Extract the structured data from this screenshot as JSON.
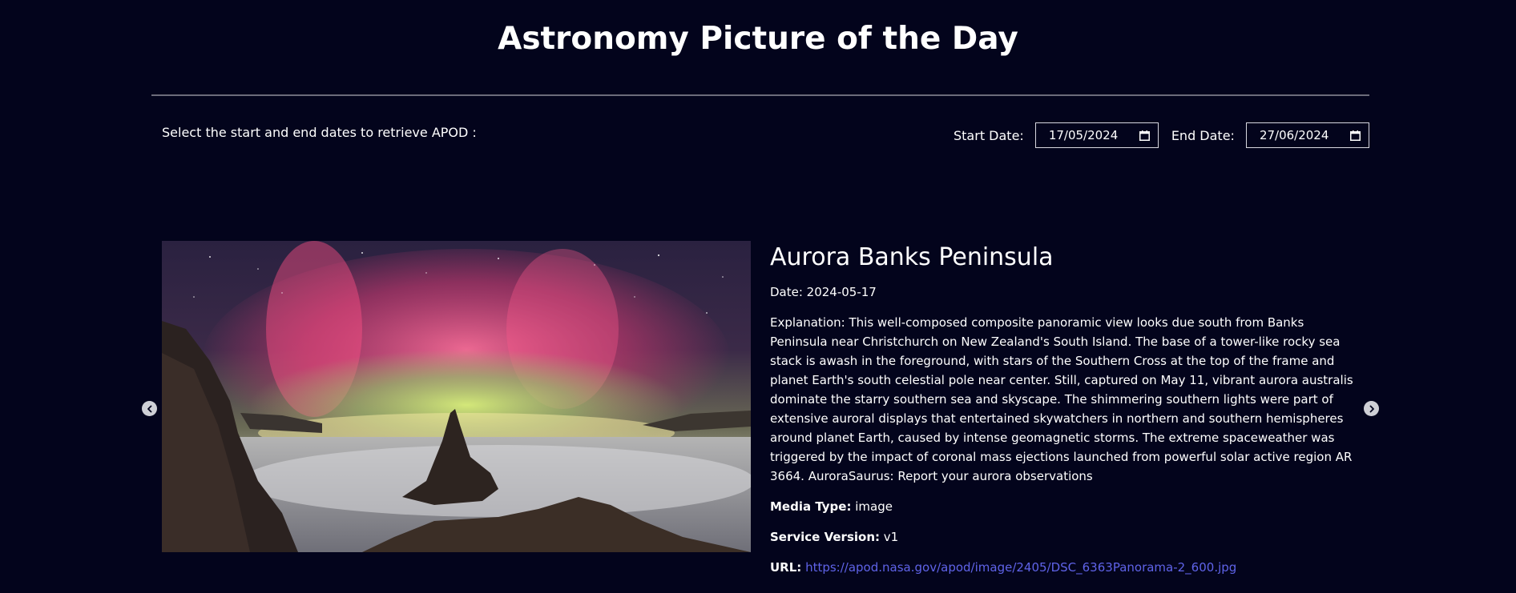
{
  "header": {
    "title": "Astronomy Picture of the Day"
  },
  "controls": {
    "prompt": "Select the start and end dates to retrieve APOD :",
    "start_label": "Start Date:",
    "start_value": "17/05/2024",
    "end_label": "End Date:",
    "end_value": "27/06/2024"
  },
  "apod": {
    "title": "Aurora Banks Peninsula",
    "date_line": "Date: 2024-05-17",
    "explanation": "Explanation: This well-composed composite panoramic view looks due south from Banks Peninsula near Christchurch on New Zealand's South Island. The base of a tower-like rocky sea stack is awash in the foreground, with stars of the Southern Cross at the top of the frame and planet Earth's south celestial pole near center. Still, captured on May 11, vibrant aurora australis dominate the starry southern sea and skyscape. The shimmering southern lights were part of extensive auroral displays that entertained skywatchers in northern and southern hemispheres around planet Earth, caused by intense geomagnetic storms. The extreme spaceweather was triggered by the impact of coronal mass ejections launched from powerful solar active region AR 3664. AuroraSaurus: Report your aurora observations",
    "media_type_label": "Media Type:",
    "media_type_value": "image",
    "service_version_label": "Service Version:",
    "service_version_value": "v1",
    "url_label": "URL:",
    "url_value": "https://apod.nasa.gov/apod/image/2405/DSC_6363Panorama-2_600.jpg"
  },
  "icons": {
    "calendar": "calendar-icon",
    "prev": "chevron-left-icon",
    "next": "chevron-right-icon"
  },
  "colors": {
    "background": "#03041c",
    "link": "#5f63e8",
    "arrow": "#cfd0d6"
  }
}
